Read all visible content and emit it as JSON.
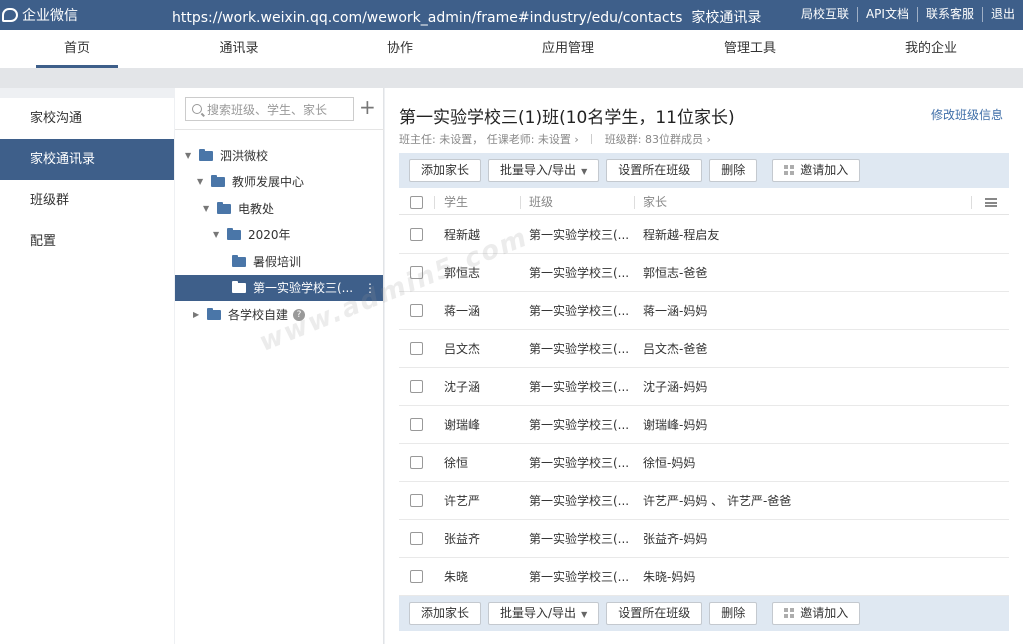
{
  "topbar": {
    "logo_text": "企业微信",
    "url": "https://work.weixin.qq.com/wework_admin/frame#industry/edu/contacts",
    "page_name": "家校通讯录",
    "links": [
      "局校互联",
      "API文档",
      "联系客服",
      "退出"
    ]
  },
  "nav": {
    "tabs": [
      "首页",
      "通讯录",
      "协作",
      "应用管理",
      "管理工具",
      "我的企业"
    ],
    "active": "首页"
  },
  "leftnav": {
    "items": [
      "家校沟通",
      "家校通讯录",
      "班级群",
      "配置"
    ],
    "active": "家校通讯录"
  },
  "tree": {
    "search_placeholder": "搜索班级、学生、家长",
    "add_icon": "plus-icon",
    "nodes": [
      {
        "label": "泗洪微校",
        "level": 0,
        "arrow": "down"
      },
      {
        "label": "教师发展中心",
        "level": 1,
        "arrow": "down"
      },
      {
        "label": "电教处",
        "level": 2,
        "arrow": "down"
      },
      {
        "label": "2020年",
        "level": 3,
        "arrow": "down"
      },
      {
        "label": "暑假培训",
        "level": 4,
        "arrow": ""
      },
      {
        "label": "第一实验学校三(...",
        "level": 4,
        "arrow": "",
        "selected": true
      },
      {
        "label": "各学校自建",
        "level": 0,
        "arrow": "right",
        "help": true
      }
    ]
  },
  "main": {
    "title": "第一实验学校三(1)班(10名学生，11位家长)",
    "edit_link": "修改班级信息",
    "head_teacher": "班主任: 未设置，",
    "teachers": "任课老师: 未设置",
    "group_info": "班级群: 83位群成员",
    "toolbar": {
      "add_parent": "添加家长",
      "import_export": "批量导入/导出",
      "set_class": "设置所在班级",
      "delete": "删除",
      "invite": "邀请加入"
    },
    "columns": [
      "学生",
      "班级",
      "家长"
    ],
    "rows": [
      {
        "student": "程新越",
        "class": "第一实验学校三(...",
        "parents": "程新越-程启友"
      },
      {
        "student": "郭恒志",
        "class": "第一实验学校三(...",
        "parents": "郭恒志-爸爸"
      },
      {
        "student": "蒋一涵",
        "class": "第一实验学校三(...",
        "parents": "蒋一涵-妈妈"
      },
      {
        "student": "吕文杰",
        "class": "第一实验学校三(...",
        "parents": "吕文杰-爸爸"
      },
      {
        "student": "沈子涵",
        "class": "第一实验学校三(...",
        "parents": "沈子涵-妈妈"
      },
      {
        "student": "谢瑞峰",
        "class": "第一实验学校三(...",
        "parents": "谢瑞峰-妈妈"
      },
      {
        "student": "徐恒",
        "class": "第一实验学校三(...",
        "parents": "徐恒-妈妈"
      },
      {
        "student": "许艺严",
        "class": "第一实验学校三(...",
        "parents": "许艺严-妈妈 、 许艺严-爸爸"
      },
      {
        "student": "张益齐",
        "class": "第一实验学校三(...",
        "parents": "张益齐-妈妈"
      },
      {
        "student": "朱晓",
        "class": "第一实验学校三(...",
        "parents": "朱晓-妈妈"
      }
    ]
  },
  "watermark": "www.admin5.com",
  "colors": {
    "brand": "#3e5f8a",
    "toolbar_bg": "#dfe8f2",
    "link": "#3e6ea8"
  }
}
